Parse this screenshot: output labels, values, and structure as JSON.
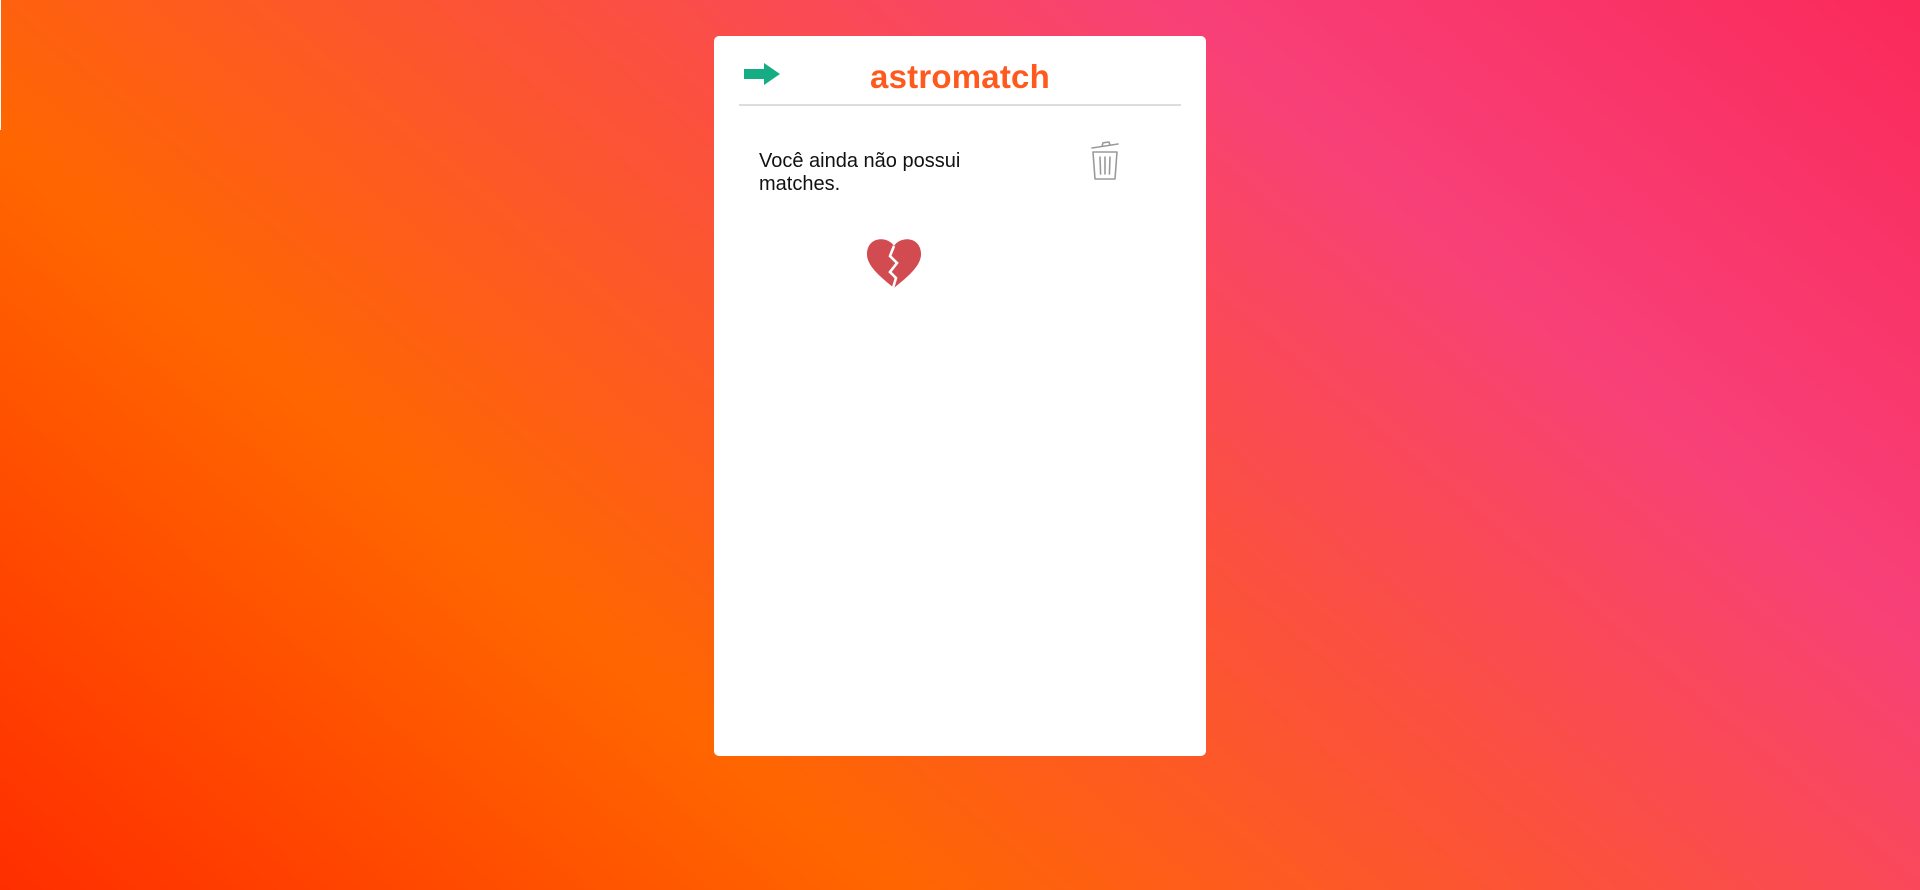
{
  "app": {
    "title": "astromatch"
  },
  "header": {
    "back_icon": "arrow-right-icon",
    "accent_color": "#16ad84",
    "title_color": "#fe5a1e"
  },
  "matches": {
    "empty_message": "Você ainda não possui matches.",
    "empty_icon": "broken-heart-icon",
    "clear_icon": "trash-icon"
  }
}
